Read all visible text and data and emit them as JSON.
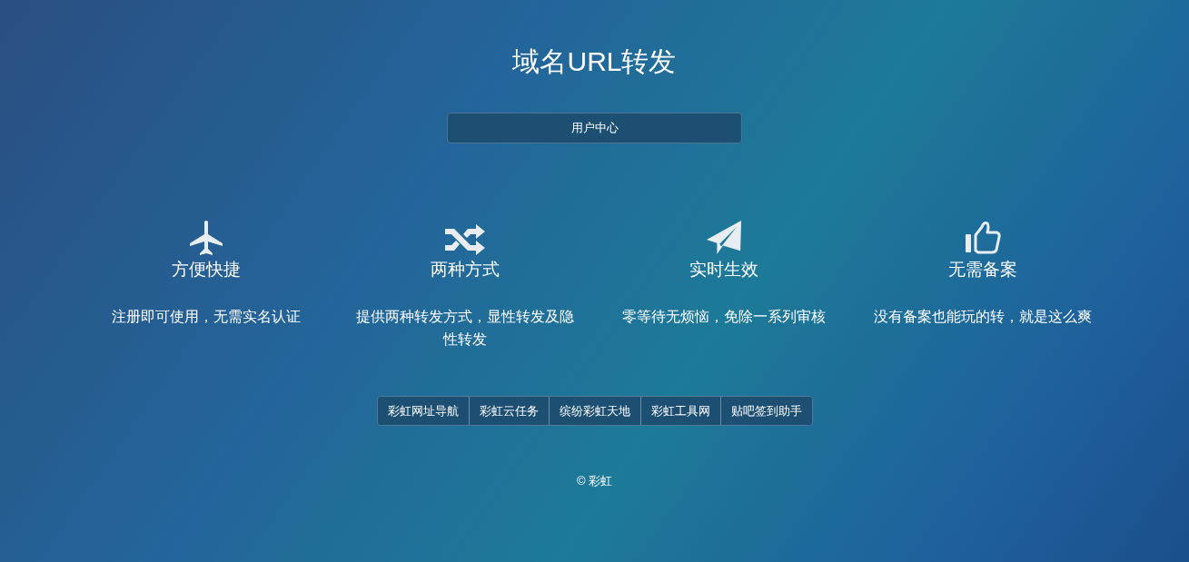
{
  "title": "域名URL转发",
  "user_center_button": "用户中心",
  "features": [
    {
      "kind": "plane",
      "title": "方便快捷",
      "description": "注册即可使用，无需实名认证"
    },
    {
      "kind": "shuffle",
      "title": "两种方式",
      "description": "提供两种转发方式，显性转发及隐性转发"
    },
    {
      "kind": "send",
      "title": "实时生效",
      "description": "零等待无烦恼，免除一系列审核"
    },
    {
      "kind": "thumb",
      "title": "无需备案",
      "description": "没有备案也能玩的转，就是这么爽"
    }
  ],
  "links": [
    "彩虹网址导航",
    "彩虹云任务",
    "缤纷彩虹天地",
    "彩虹工具网",
    "贴吧签到助手"
  ],
  "footer": "© 彩虹"
}
